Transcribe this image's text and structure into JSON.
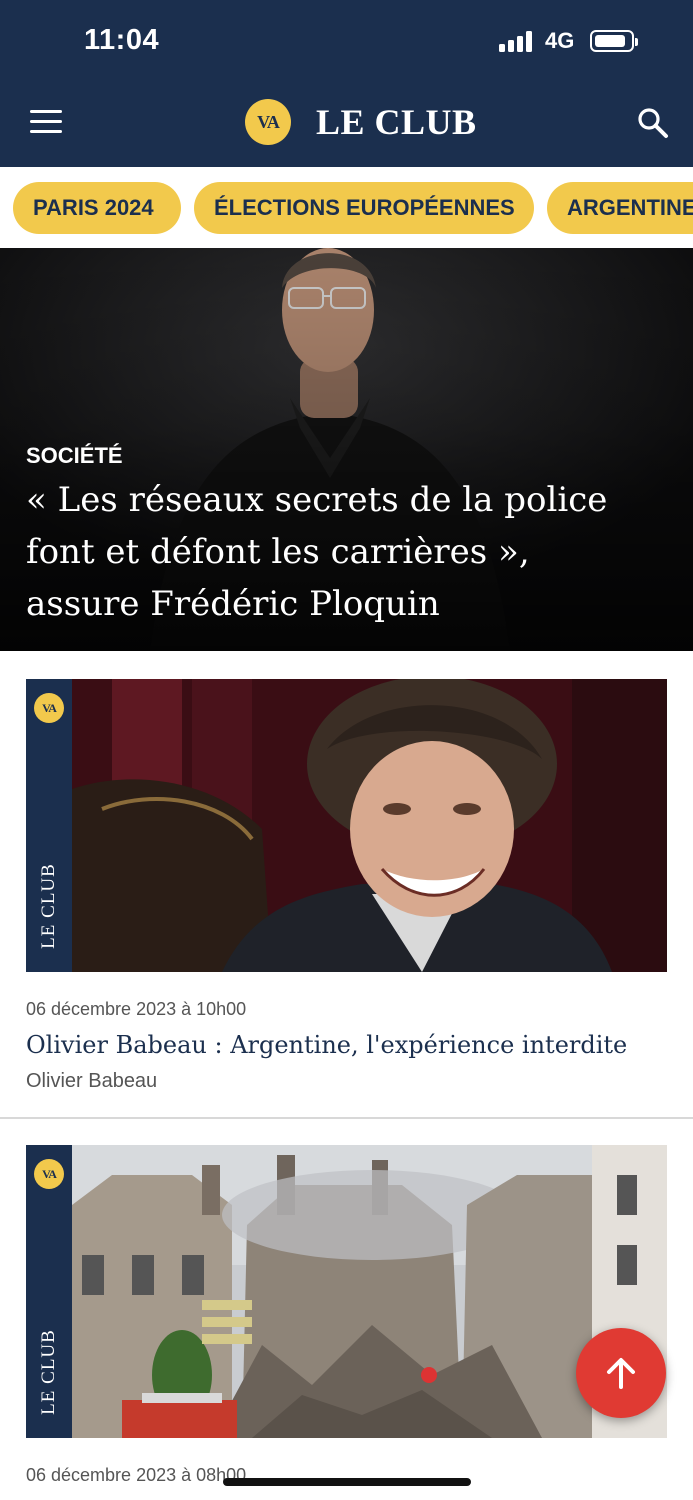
{
  "status_bar": {
    "time": "11:04",
    "network": "4G"
  },
  "header": {
    "logo_text": "VA",
    "title": "LE CLUB",
    "menu_icon": "hamburger-icon",
    "search_icon": "search-icon"
  },
  "topics": [
    {
      "label": "PARIS 2024"
    },
    {
      "label": "ÉLECTIONS EUROPÉENNES"
    },
    {
      "label": "ARGENTINE"
    }
  ],
  "hero": {
    "category": "SOCIÉTÉ",
    "title_lines": [
      "« Les réseaux secrets de la police",
      "font et défont les carrières »,",
      "assure Frédéric Ploquin"
    ]
  },
  "articles": [
    {
      "badge": "LE CLUB",
      "logo": "VA",
      "date": "06 décembre 2023 à 10h00",
      "title": "Olivier Babeau : Argentine, l'expérience interdite",
      "author": "Olivier Babeau"
    },
    {
      "badge": "LE CLUB",
      "logo": "VA",
      "date": "06 décembre 2023 à 08h00"
    }
  ],
  "colors": {
    "navy": "#1b2f4e",
    "gold": "#f2c94c",
    "fab_red": "#e03a33"
  },
  "fab": {
    "icon": "arrow-up-icon"
  }
}
